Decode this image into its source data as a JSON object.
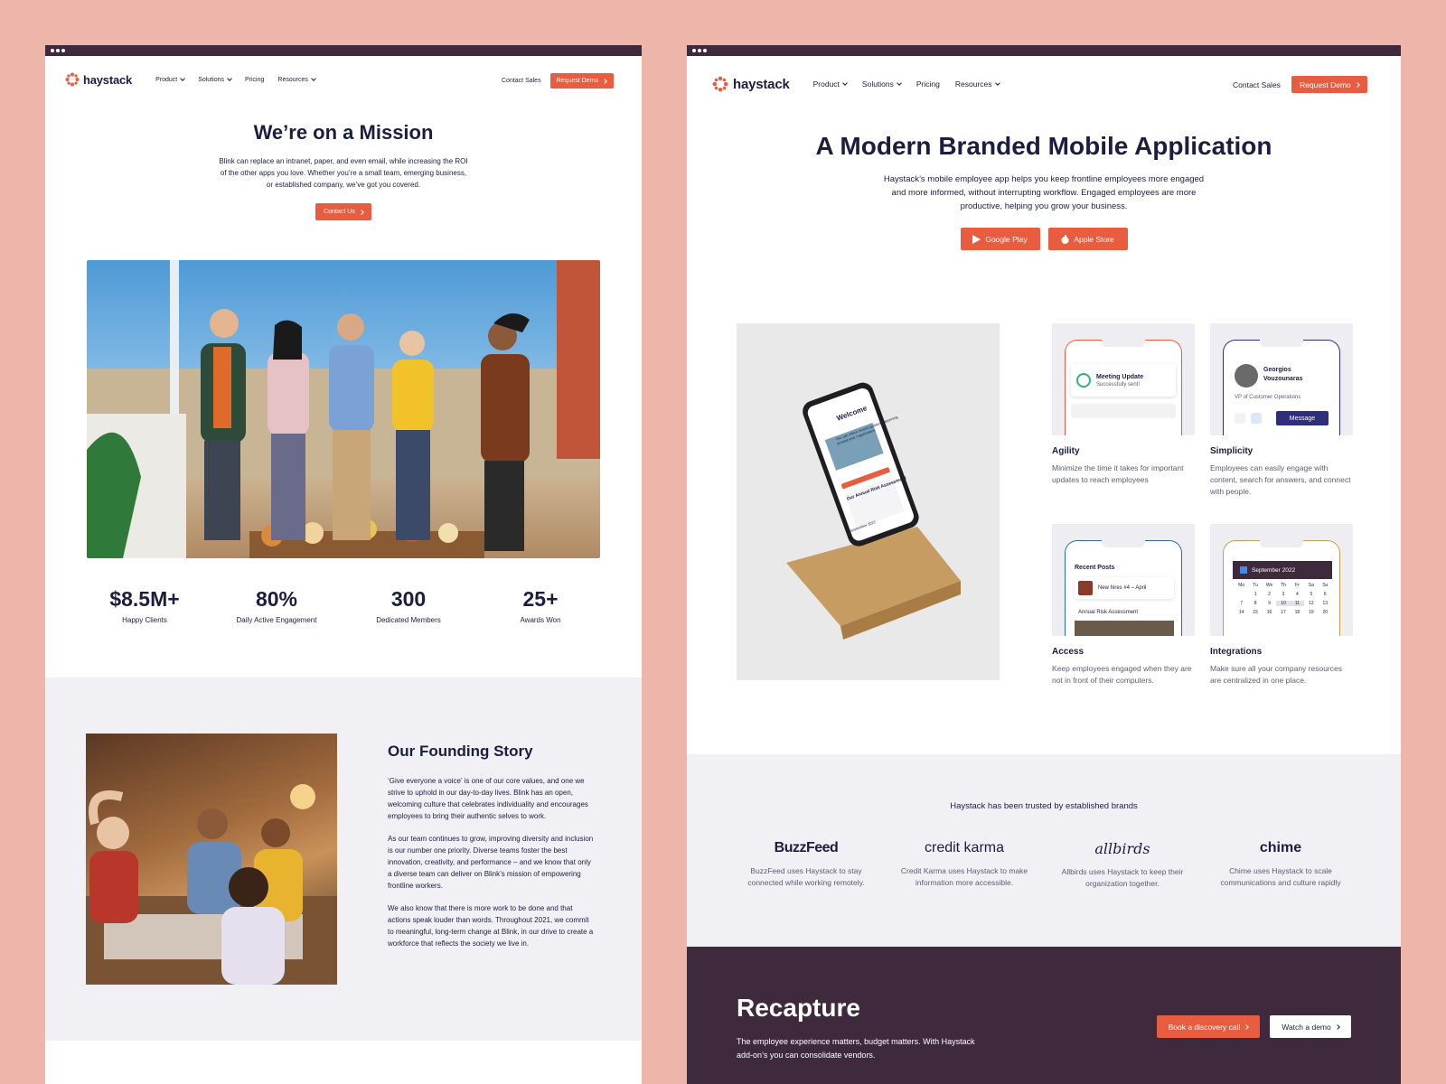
{
  "left": {
    "nav": {
      "logo": "haystack",
      "links": [
        "Product",
        "Solutions",
        "Pricing",
        "Resources"
      ],
      "contact": "Contact Sales",
      "demo": "Request Demo"
    },
    "hero": {
      "title": "We’re on a Mission",
      "text": "Blink can replace an intranet, paper, and even email, while increasing the ROI of the other apps you love. Whether you’re a small team, emerging business, or established company, we’ve got you covered.",
      "button": "Contact Us"
    },
    "stats": [
      {
        "value": "$8.5M+",
        "label": "Happy Clients"
      },
      {
        "value": "80%",
        "label": "Daily Active Engagement"
      },
      {
        "value": "300",
        "label": "Dedicated Members"
      },
      {
        "value": "25+",
        "label": "Awards Won"
      }
    ],
    "story": {
      "title": "Our Founding Story",
      "p1": "‘Give everyone a voice’ is one of our core values, and one we strive to uphold in our day-to-day lives. Blink has an open, welcoming culture that celebrates individuality and encourages employees to bring their authentic selves to work.",
      "p2": "As our team continues to grow, improving diversity and inclusion is our number one priority. Diverse teams foster the best innovation, creativity, and performance – and we know that only a diverse team can deliver on Blink’s mission of empowering frontline workers.",
      "p3": "We also know that there is more work to be done and that actions speak louder than words. Throughout 2021, we commit to meaningful, long-term change at Blink, in our drive to create a workforce that reflects the society we live in."
    }
  },
  "right": {
    "nav": {
      "logo": "haystack",
      "links": [
        "Product",
        "Solutions",
        "Pricing",
        "Resources"
      ],
      "contact": "Contact Sales",
      "demo": "Request Demo"
    },
    "hero": {
      "title": "A Modern Branded Mobile Application",
      "text": "Haystack’s mobile employee app helps you keep frontline employees more engaged and more informed, without interrupting workflow. Engaged employees are more productive, helping you grow your business.",
      "google": "Google Play",
      "apple": "Apple Store"
    },
    "phone": {
      "welcome": "Welcome",
      "sub": "You can check recent updates happening around your organization.",
      "post": "Our Annual Risk Assessment",
      "month": "September 2022"
    },
    "features": [
      {
        "title": "Agility",
        "text": "Minimize the time it takes for important updates to reach employees",
        "t1": "Meeting Update",
        "t2": "Successfully sent!"
      },
      {
        "title": "Simplicity",
        "text": "Employees can easily engage with content, search for answers, and connect with people.",
        "t1": "Georgios Vouzounaras",
        "t2": "VP of Customer Operations",
        "t3": "Message"
      },
      {
        "title": "Access",
        "text": "Keep employees engaged when they are not in front of their computers.",
        "t1": "Recent Posts",
        "t2": "New hires #4 – April",
        "t3": "Annual Risk Assessment"
      },
      {
        "title": "Integrations",
        "text": "Make sure all your company resources are centralized in one place.",
        "t1": "September 2022",
        "days": [
          "Mo",
          "Tu",
          "We",
          "Th",
          "Fr",
          "Sa",
          "Su"
        ],
        "nums": [
          "1",
          "2",
          "3",
          "4",
          "5",
          "6",
          "7",
          "8",
          "9",
          "10",
          "11",
          "12",
          "13",
          "14",
          "15",
          "16",
          "17",
          "18",
          "19",
          "20"
        ]
      }
    ],
    "trusted": {
      "title": "Haystack has been trusted by established brands",
      "brands": [
        {
          "name": "BuzzFeed",
          "text": "BuzzFeed uses Haystack to stay connected while working remotely."
        },
        {
          "name": "credit karma",
          "text": "Credit Karma uses Haystack to make information more accessible."
        },
        {
          "name": "allbirds",
          "text": "Allbirds uses Haystack to keep their organization together."
        },
        {
          "name": "chime",
          "text": "Chime uses Haystack to scale communications and culture rapidly"
        }
      ]
    },
    "cta": {
      "title": "Recapture",
      "text": "The employee experience matters, budget matters. With Haystack add-on’s you can consolidate vendors.",
      "book": "Book a discovery call",
      "watch": "Watch a demo"
    }
  },
  "colors": {
    "accent": "#e85d3f",
    "navy": "#1c1d3f",
    "plum": "#3e2a3c",
    "background": "#eeb5aa"
  }
}
